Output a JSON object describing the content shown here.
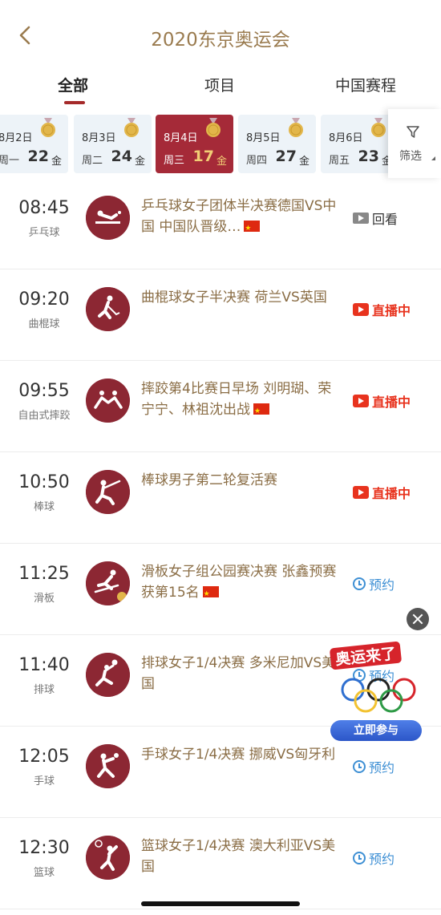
{
  "header": {
    "title": "2020东京奥运会"
  },
  "tabs": [
    {
      "label": "全部",
      "active": true
    },
    {
      "label": "项目",
      "active": false
    },
    {
      "label": "中国赛程",
      "active": false
    }
  ],
  "dates": [
    {
      "date": "8月2日",
      "weekday": "周一",
      "gold": "22",
      "unit": "金",
      "active": false
    },
    {
      "date": "8月3日",
      "weekday": "周二",
      "gold": "24",
      "unit": "金",
      "active": false
    },
    {
      "date": "8月4日",
      "weekday": "周三",
      "gold": "17",
      "unit": "金",
      "active": true
    },
    {
      "date": "8月5日",
      "weekday": "周四",
      "gold": "27",
      "unit": "金",
      "active": false
    },
    {
      "date": "8月6日",
      "weekday": "周五",
      "gold": "23",
      "unit": "金",
      "active": false
    }
  ],
  "filter": {
    "label": "筛选"
  },
  "events": [
    {
      "time": "08:45",
      "sport": "乒乓球",
      "title": "乒乓球女子团体半决赛德国VS中国 中国队晋级…",
      "action": "回看",
      "type": "replay"
    },
    {
      "time": "09:20",
      "sport": "曲棍球",
      "title": "曲棍球女子半决赛 荷兰VS英国",
      "action": "直播中",
      "type": "live"
    },
    {
      "time": "09:55",
      "sport": "自由式摔跤",
      "title": "摔跤第4比赛日早场 刘明瑚、荣宁宁、林祖沈出战",
      "action": "直播中",
      "type": "live"
    },
    {
      "time": "10:50",
      "sport": "棒球",
      "title": "棒球男子第二轮复活赛",
      "action": "直播中",
      "type": "live"
    },
    {
      "time": "11:25",
      "sport": "滑板",
      "title": "滑板女子组公园赛决赛 张鑫预赛获第15名",
      "action": "预约",
      "type": "reserve"
    },
    {
      "time": "11:40",
      "sport": "排球",
      "title": "排球女子1/4决赛 多米尼加VS美国",
      "action": "预约",
      "type": "reserve"
    },
    {
      "time": "12:05",
      "sport": "手球",
      "title": "手球女子1/4决赛 挪威VS匈牙利",
      "action": "预约",
      "type": "reserve"
    },
    {
      "time": "12:30",
      "sport": "篮球",
      "title": "篮球女子1/4决赛 澳大利亚VS美国",
      "action": "预约",
      "type": "reserve"
    }
  ],
  "ad": {
    "title": "奥运来了",
    "button": "立即参与"
  },
  "colors": {
    "accent": "#a52a38",
    "gold_text": "#9a7b4f",
    "live": "#e8331e",
    "reserve": "#3d8fd4"
  }
}
